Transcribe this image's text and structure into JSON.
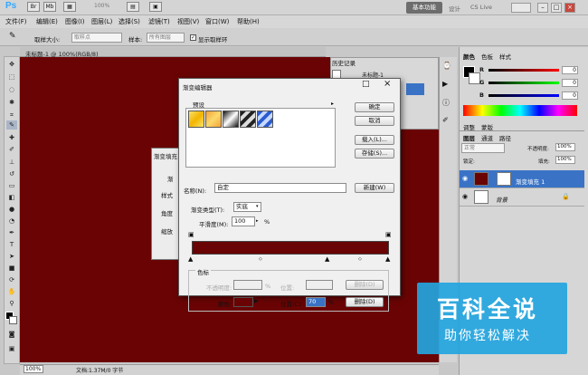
{
  "app": {
    "logo": "Ps",
    "zoom": "100%",
    "basic_workspace": "基本功能",
    "workspaces": [
      "设计",
      "绘画"
    ],
    "cs_live": "CS Live"
  },
  "menu": [
    "文件(F)",
    "编辑(E)",
    "图像(I)",
    "图层(L)",
    "选择(S)",
    "滤镜(T)",
    "视图(V)",
    "窗口(W)",
    "帮助(H)"
  ],
  "options": {
    "sample_size_label": "取样大小:",
    "sample_size_value": "取样点",
    "sample_label": "样本:",
    "sample_value": "所有图层",
    "show_ring": "显示取样环"
  },
  "document": {
    "tab": "未标题-1 @ 100%(RGB/8)",
    "status_zoom": "100%",
    "status_doc": "文档:1.37M/0 字节"
  },
  "history": {
    "tab": "历史记录",
    "item": "未标题-1"
  },
  "color_panel": {
    "tabs": [
      "颜色",
      "色板",
      "样式"
    ],
    "labels": [
      "R",
      "G",
      "B"
    ],
    "values": [
      "0",
      "0",
      "0"
    ]
  },
  "layers_panel": {
    "mini_tabs": [
      "调整",
      "蒙版"
    ],
    "tabs": [
      "图层",
      "通道",
      "路径"
    ],
    "mode": "正常",
    "opacity_label": "不透明度:",
    "opacity": "100%",
    "fill_label": "填充:",
    "fill": "100%",
    "lock_label": "锁定:",
    "layers": [
      {
        "name": "渐变填充 1"
      },
      {
        "name": "背景"
      }
    ]
  },
  "under_dialog": {
    "title": "渐变填充",
    "labels": [
      "渐",
      "样式",
      "角度",
      "缩放"
    ]
  },
  "dialog": {
    "title": "渐变编辑器",
    "presets_label": "预设",
    "buttons": {
      "ok": "确定",
      "cancel": "取消",
      "load": "载入(L)...",
      "save": "存储(S)...",
      "new": "新建(W)"
    },
    "name_label": "名称(N):",
    "name_value": "自定",
    "type_label": "渐变类型(T):",
    "type_value": "实底",
    "smooth_label": "平滑度(M):",
    "smooth_value": "100",
    "smooth_unit": "%",
    "stops_group": "色标",
    "opacity_label": "不透明度:",
    "opacity_unit": "%",
    "location_label1": "位置:",
    "delete_label1": "删除(D)",
    "color_label": "颜色:",
    "location_label2": "位置(C):",
    "location_value": "70",
    "location_unit": "%",
    "delete_label2": "删除(D)"
  },
  "watermark": {
    "line1": "百科全说",
    "line2": "助你轻松解决"
  },
  "colors": {
    "canvas": "#6a0404",
    "selection": "#3a73c6",
    "watermark": "#23a5de"
  }
}
